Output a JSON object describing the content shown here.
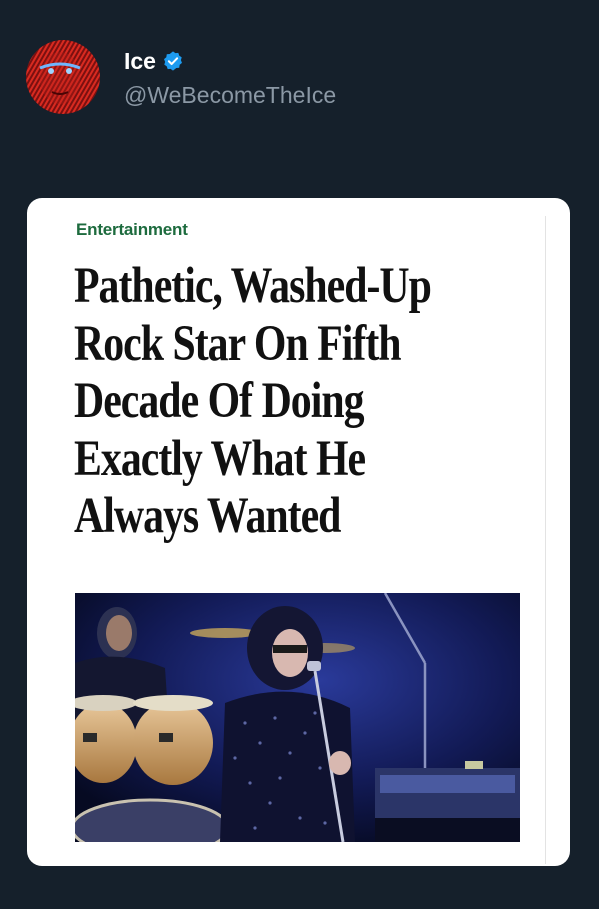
{
  "author": {
    "display_name": "Ice",
    "handle": "@WeBecomeTheIce",
    "verified": true,
    "avatar_icon": "avatar-red-portrait",
    "verified_icon": "verified-badge-icon",
    "verified_color": "#1d9bf0"
  },
  "article": {
    "category": "Entertainment",
    "category_color": "#1d6b3e",
    "headline_lines": [
      "Pathetic, Washed-Up",
      "Rock Star On Fifth",
      "Decade Of Doing",
      "Exactly What He",
      "Always Wanted"
    ],
    "image_description_icon": "rock-concert-photo"
  },
  "theme": {
    "background": "#15202b",
    "card_background": "#ffffff",
    "handle_color": "#8b98a5"
  }
}
